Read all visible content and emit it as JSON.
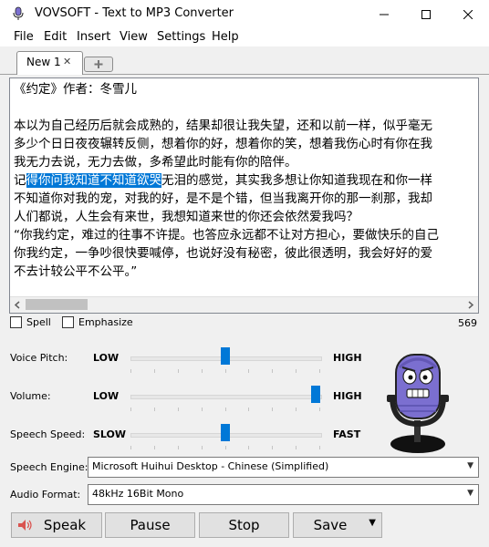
{
  "window": {
    "title": "VOVSOFT - Text to MP3 Converter"
  },
  "menu": [
    "File",
    "Edit",
    "Insert",
    "View",
    "Settings",
    "Help"
  ],
  "tabs": {
    "active_label": "New 1"
  },
  "editor": {
    "lines": [
      {
        "before": "《约定》作者：冬雪儿",
        "selected": "",
        "after": ""
      },
      {
        "before": "",
        "selected": "",
        "after": ""
      },
      {
        "before": "本以为自己经历后就会成熟的，结果却很让我失望，还和以前一样，似乎毫无",
        "selected": "",
        "after": ""
      },
      {
        "before": "多少个日日夜夜辗转反侧，想着你的好，想着你的笑，想着我伤心时有你在我",
        "selected": "",
        "after": ""
      },
      {
        "before": "我无力去说，无力去做，多希望此时能有你的陪伴。",
        "selected": "",
        "after": ""
      },
      {
        "before": "记",
        "selected": "得你问我知道不知道欲哭",
        "after": "无泪的感觉，其实我多想让你知道我现在和你一样"
      },
      {
        "before": "不知道你对我的宠，对我的好，是不是个错，但当我离开你的那一刹那，我却",
        "selected": "",
        "after": ""
      },
      {
        "before": "人们都说，人生会有来世，我想知道来世的你还会依然爱我吗？",
        "selected": "",
        "after": ""
      },
      {
        "before": "“你我约定，难过的往事不许提。也答应永远都不让对方担心，要做快乐的自己",
        "selected": "",
        "after": ""
      },
      {
        "before": "你我约定，一争吵很快要喊停，也说好没有秘密，彼此很透明，我会好好的爱",
        "selected": "",
        "after": ""
      },
      {
        "before": "不去计较公平不公平。”",
        "selected": "",
        "after": ""
      }
    ]
  },
  "options": {
    "spell_label": "Spell",
    "emphasize_label": "Emphasize",
    "char_count": "569"
  },
  "sliders": [
    {
      "label": "Voice Pitch:",
      "low": "LOW",
      "high": "HIGH",
      "value": 0.5
    },
    {
      "label": "Volume:",
      "low": "LOW",
      "high": "HIGH",
      "value": 1.0
    },
    {
      "label": "Speech Speed:",
      "low": "SLOW",
      "high": "FAST",
      "value": 0.5
    }
  ],
  "engine": {
    "label": "Speech Engine:",
    "value": "Microsoft Huihui Desktop - Chinese (Simplified)"
  },
  "format": {
    "label": "Audio Format:",
    "value": "48kHz 16Bit Mono"
  },
  "buttons": {
    "speak": "Speak",
    "pause": "Pause",
    "stop": "Stop",
    "save": "Save"
  },
  "colors": {
    "accent": "#0078d7",
    "mascot": "#7b6fd0"
  }
}
